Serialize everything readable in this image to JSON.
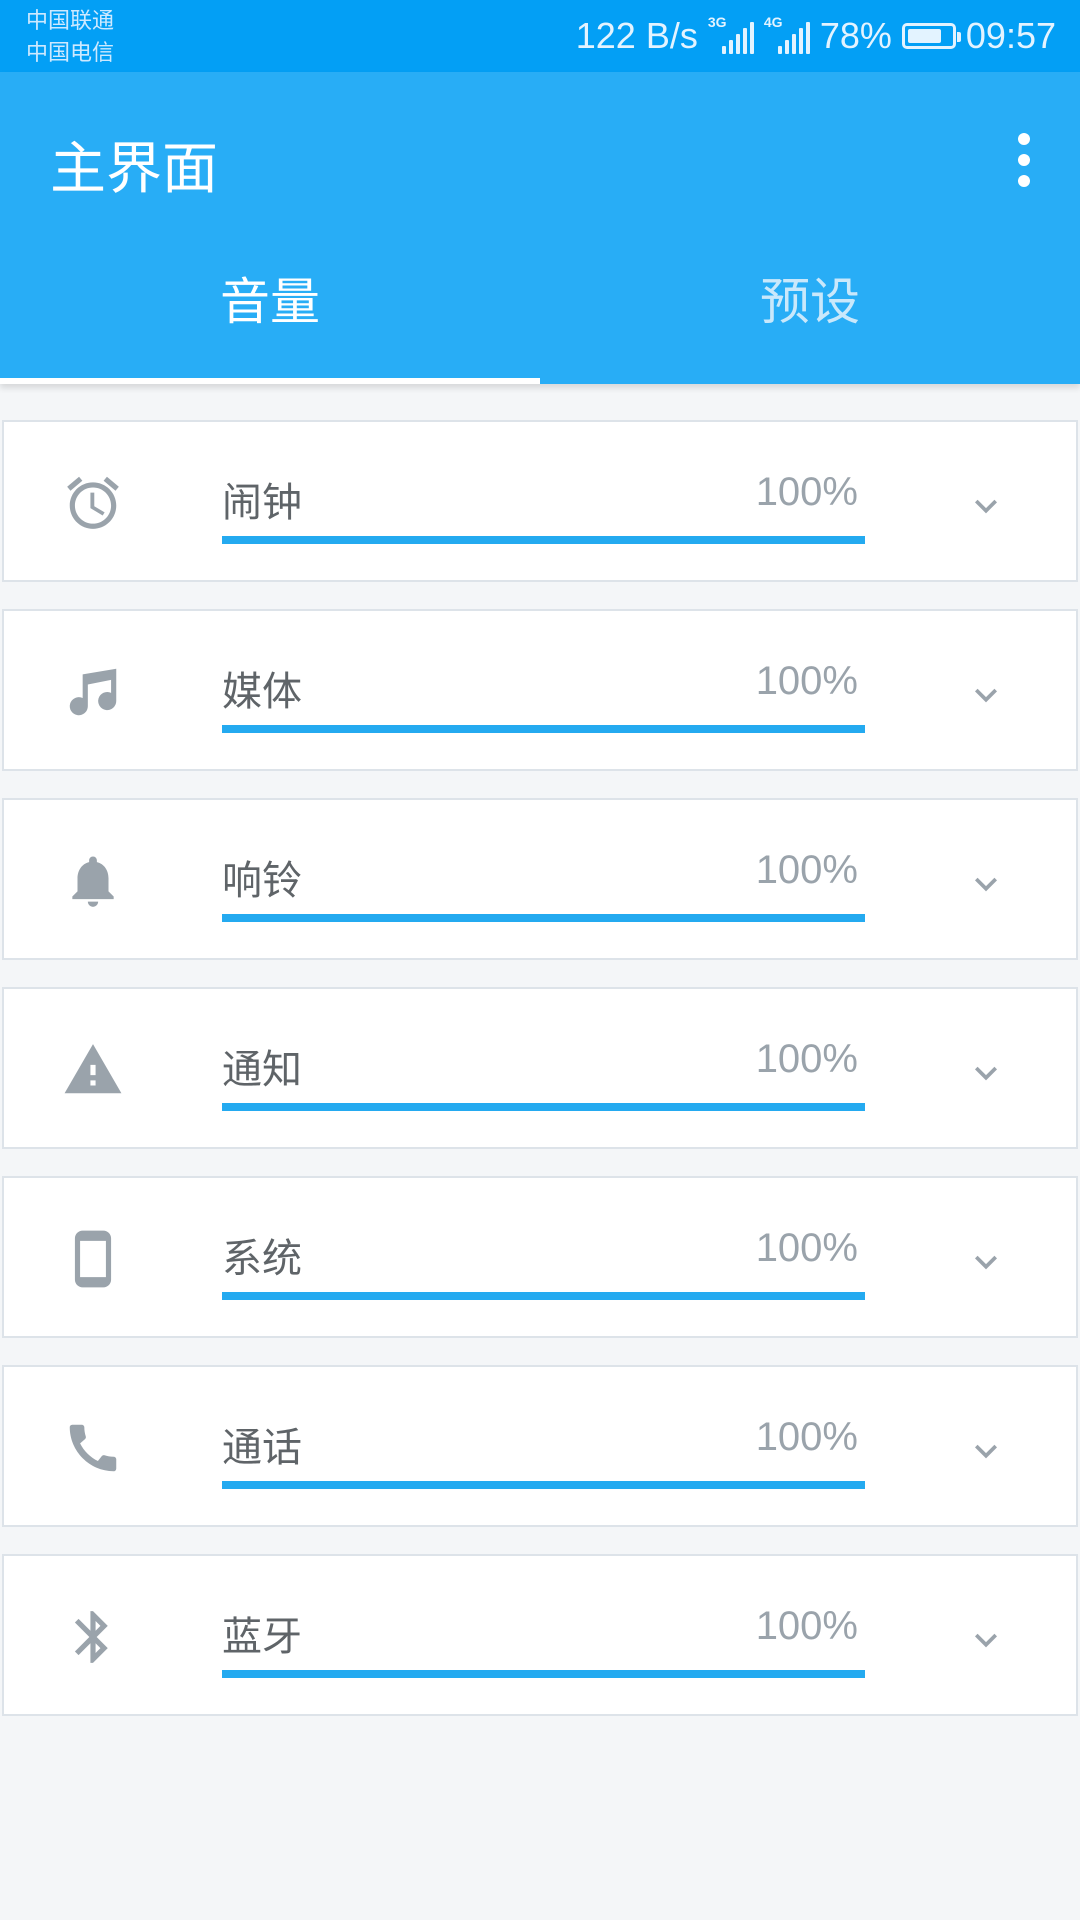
{
  "status_bar": {
    "carrier_1": "中国联通",
    "carrier_2": "中国电信",
    "speed": "122 B/s",
    "net_1": "3G",
    "net_2": "4G",
    "battery": "78%",
    "battery_level": 0.78,
    "time": "09:57"
  },
  "app_bar": {
    "title": "主界面",
    "menu_icon": "more-vert-icon"
  },
  "tabs": [
    {
      "label": "音量",
      "active": true
    },
    {
      "label": "预设",
      "active": false
    }
  ],
  "colors": {
    "status_bar": "#039ff5",
    "app_bar": "#28adf6",
    "accent": "#24aaf0",
    "icon": "#9aa3ab"
  },
  "volumes": [
    {
      "label": "闹钟",
      "percent": "100%",
      "level": 1.0,
      "icon": "alarm-icon"
    },
    {
      "label": "媒体",
      "percent": "100%",
      "level": 1.0,
      "icon": "music-note-icon"
    },
    {
      "label": "响铃",
      "percent": "100%",
      "level": 1.0,
      "icon": "bell-icon"
    },
    {
      "label": "通知",
      "percent": "100%",
      "level": 1.0,
      "icon": "warning-icon"
    },
    {
      "label": "系统",
      "percent": "100%",
      "level": 1.0,
      "icon": "phone-device-icon"
    },
    {
      "label": "通话",
      "percent": "100%",
      "level": 1.0,
      "icon": "call-icon"
    },
    {
      "label": "蓝牙",
      "percent": "100%",
      "level": 1.0,
      "icon": "bluetooth-icon"
    }
  ]
}
